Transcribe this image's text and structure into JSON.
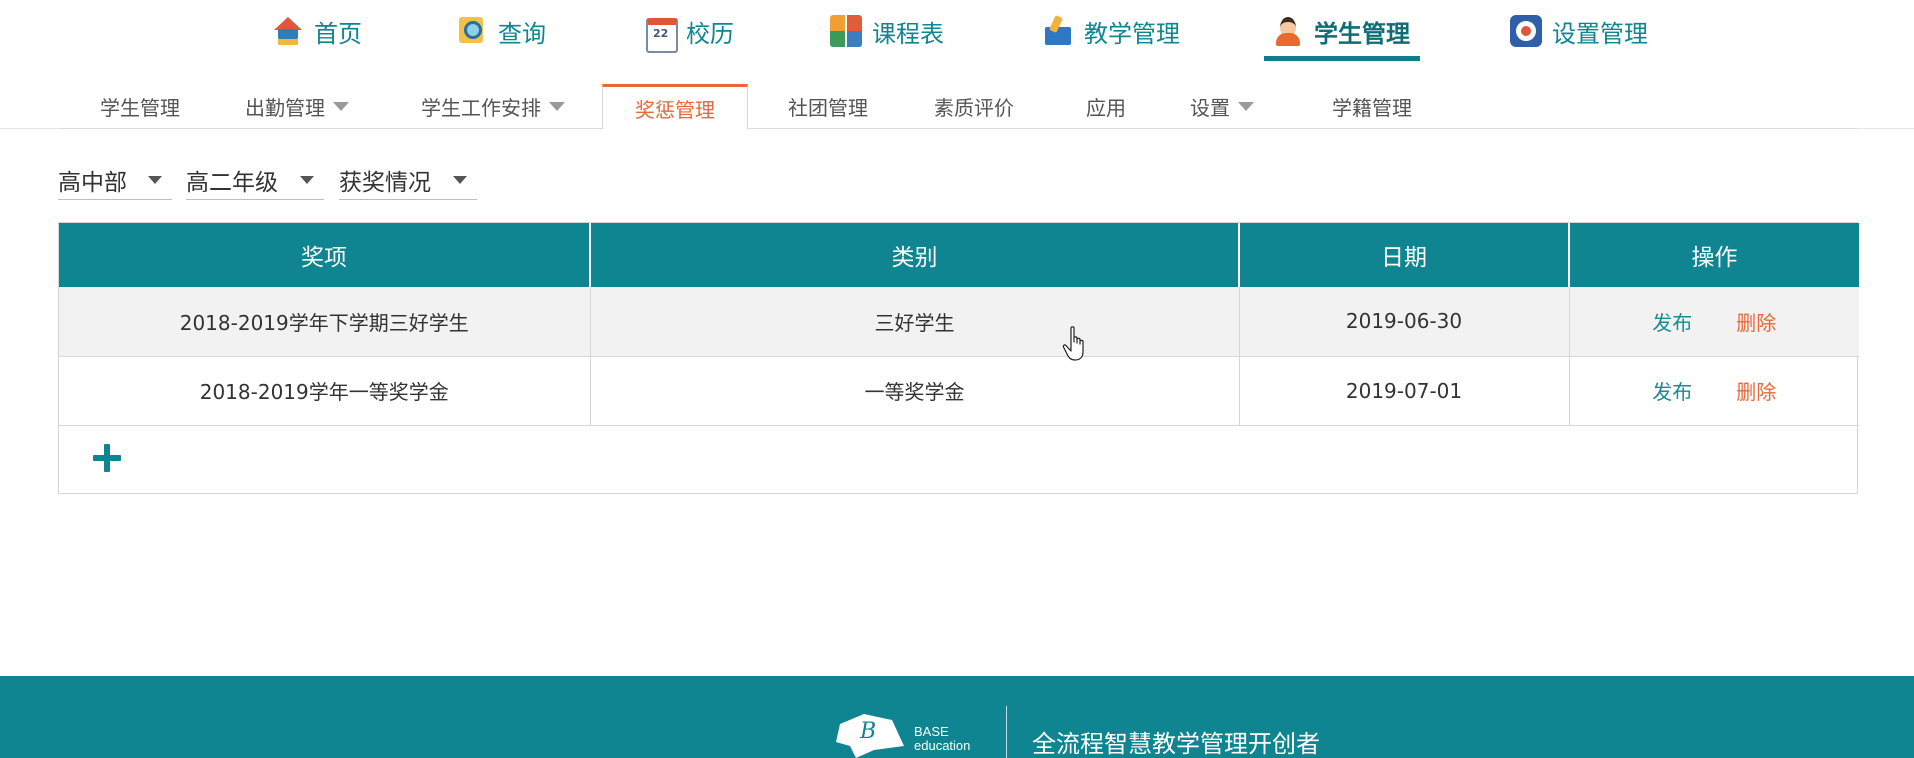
{
  "topnav": {
    "items": [
      {
        "label": "首页",
        "icon": "home-icon"
      },
      {
        "label": "查询",
        "icon": "search-icon"
      },
      {
        "label": "校历",
        "icon": "calendar-icon"
      },
      {
        "label": "课程表",
        "icon": "schedule-icon"
      },
      {
        "label": "教学管理",
        "icon": "teaching-icon"
      },
      {
        "label": "学生管理",
        "icon": "student-icon",
        "active": true
      },
      {
        "label": "设置管理",
        "icon": "gear-icon"
      }
    ]
  },
  "subnav": {
    "tabs": [
      {
        "label": "学生管理",
        "dropdown": false
      },
      {
        "label": "出勤管理",
        "dropdown": true
      },
      {
        "label": "学生工作安排",
        "dropdown": true
      },
      {
        "label": "奖惩管理",
        "dropdown": false,
        "active": true
      },
      {
        "label": "社团管理",
        "dropdown": false
      },
      {
        "label": "素质评价",
        "dropdown": false
      },
      {
        "label": "应用",
        "dropdown": false
      },
      {
        "label": "设置",
        "dropdown": true
      },
      {
        "label": "学籍管理",
        "dropdown": false
      }
    ]
  },
  "filters": {
    "section": "高中部",
    "grade": "高二年级",
    "type": "获奖情况"
  },
  "table": {
    "headers": [
      "奖项",
      "类别",
      "日期",
      "操作"
    ],
    "rows": [
      {
        "award": "2018-2019学年下学期三好学生",
        "category": "三好学生",
        "date": "2019-06-30",
        "publish": "发布",
        "delete": "删除"
      },
      {
        "award": "2018-2019学年一等奖学金",
        "category": "一等奖学金",
        "date": "2019-07-01",
        "publish": "发布",
        "delete": "删除"
      }
    ]
  },
  "footer": {
    "brand_line1": "BASE",
    "brand_line2": "education",
    "slogan": "全流程智慧教学管理开创者"
  },
  "colors": {
    "primary": "#0e8590",
    "accent": "#e8683a",
    "row_alt": "#f2f2f2"
  }
}
